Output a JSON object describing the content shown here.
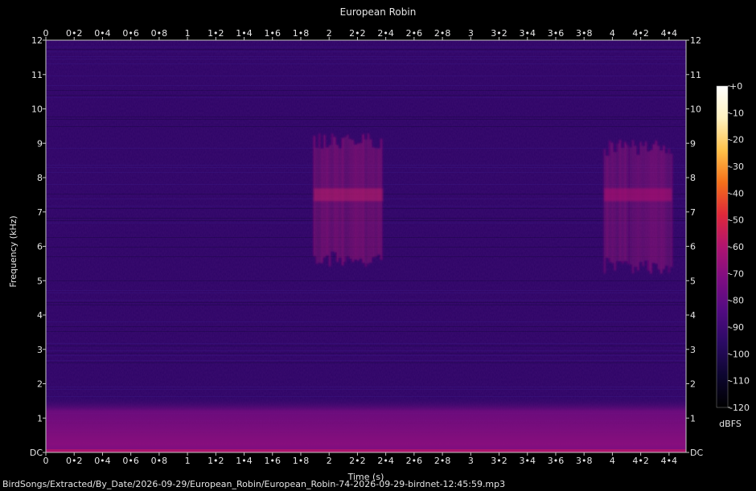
{
  "chart_data": {
    "type": "heatmap",
    "title": "European Robin",
    "xlabel": "Time (s)",
    "ylabel": "Frequency (kHz)",
    "xlim": [
      0,
      4.52
    ],
    "ylim": [
      0,
      12
    ],
    "x_ticks": [
      "0",
      "0•2",
      "0•4",
      "0•6",
      "0•8",
      "1",
      "1•2",
      "1•4",
      "1•6",
      "1•8",
      "2",
      "2•2",
      "2•4",
      "2•6",
      "2•8",
      "3",
      "3•2",
      "3•4",
      "3•6",
      "3•8",
      "4",
      "4•2",
      "4•4"
    ],
    "x_tick_values": [
      0,
      0.2,
      0.4,
      0.6,
      0.8,
      1,
      1.2,
      1.4,
      1.6,
      1.8,
      2,
      2.2,
      2.4,
      2.6,
      2.8,
      3,
      3.2,
      3.4,
      3.6,
      3.8,
      4,
      4.2,
      4.4
    ],
    "y_ticks": [
      "DC",
      "1",
      "2",
      "3",
      "4",
      "5",
      "6",
      "7",
      "8",
      "9",
      "10",
      "11",
      "12"
    ],
    "y_tick_values": [
      0,
      1,
      2,
      3,
      4,
      5,
      6,
      7,
      8,
      9,
      10,
      11,
      12
    ],
    "colorbar": {
      "label": "dBFS",
      "ticks": [
        "+0",
        "-10",
        "-20",
        "-30",
        "-40",
        "-50",
        "-60",
        "-70",
        "-80",
        "-90",
        "-100",
        "-110",
        "-120"
      ],
      "tick_values": [
        0,
        -10,
        -20,
        -30,
        -40,
        -50,
        -60,
        -70,
        -80,
        -90,
        -100,
        -110,
        -120
      ],
      "range": [
        -120,
        0
      ],
      "colors": [
        "#000000",
        "#0d0630",
        "#2a0a63",
        "#520b82",
        "#7e0d82",
        "#b01470",
        "#e0283a",
        "#f5701a",
        "#ffc24a",
        "#fff2c0",
        "#ffffff"
      ]
    },
    "background_dbfs": -92,
    "low_band": {
      "freq_khz": [
        0,
        1.6
      ],
      "dbfs": -72
    },
    "calls": [
      {
        "t_start": 1.89,
        "t_end": 2.38,
        "f_low_khz": 5.4,
        "f_high_khz": 9.3,
        "peak_freq_khz": 7.5,
        "dbfs": -58
      },
      {
        "t_start": 3.94,
        "t_end": 4.42,
        "f_low_khz": 5.2,
        "f_high_khz": 9.1,
        "peak_freq_khz": 7.5,
        "dbfs": -60
      }
    ]
  },
  "footer": {
    "filename": "BirdSongs/Extracted/By_Date/2026-09-29/European_Robin/European_Robin-74-2026-09-29-birdnet-12:45:59.mp3"
  }
}
